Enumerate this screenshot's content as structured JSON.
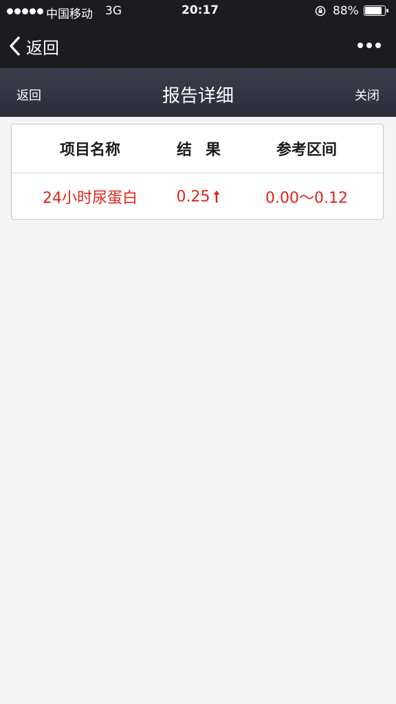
{
  "status_bar": {
    "carrier": "中国移动",
    "network": "3G",
    "time": "20:17",
    "battery_percent": "88%",
    "battery_level": 0.88,
    "signal_bars": 5
  },
  "nav": {
    "back_label": "返回",
    "more_icon": "more-dots-icon"
  },
  "sub_header": {
    "back_label": "返回",
    "title": "报告详细",
    "close_label": "关闭"
  },
  "table": {
    "columns": [
      "项目名称",
      "结果",
      "参考区间"
    ],
    "rows": [
      {
        "name": "24小时尿蛋白",
        "result": "0.25",
        "flag": "high",
        "flag_icon": "up-arrow-icon",
        "range": "0.00～0.12"
      }
    ]
  },
  "colors": {
    "bar_background": "#1c1c20",
    "subheader_background": "#32353f",
    "page_background": "#f4f4f4",
    "abnormal_text": "#e0231b"
  }
}
